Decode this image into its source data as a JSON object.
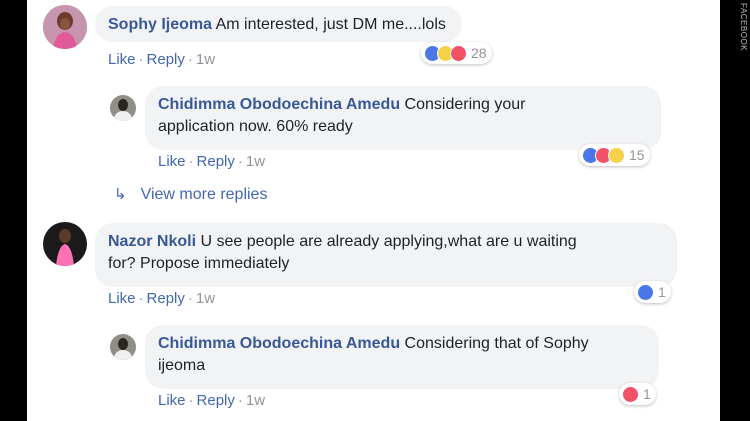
{
  "watermark": "FACEBOOK",
  "colors": {
    "name": "#385898",
    "link": "#4267b2",
    "meta": "#90949c",
    "bubble": "#f2f3f5",
    "like": "#4a76e8",
    "love": "#f25268",
    "wow": "#f7d04a"
  },
  "actions": {
    "like": "Like",
    "reply": "Reply",
    "sep": "·"
  },
  "view_more": {
    "label": "View more replies",
    "icon": "reply-arrow-icon"
  },
  "comments": [
    {
      "name": "Sophy Ijeoma",
      "text": "Am interested, just DM me....lols",
      "time": "1w",
      "reactions": [
        "like-icon",
        "wow-icon",
        "love-icon"
      ],
      "count": "28"
    },
    {
      "name": "Chidimma Obodoechina Amedu",
      "text1": "Considering your",
      "text2": "application now. 60% ready",
      "time": "1w",
      "reactions": [
        "like-icon",
        "love-icon",
        "wow-icon"
      ],
      "count": "15"
    },
    {
      "name": "Nazor Nkoli",
      "text1": "U see people are already applying,what are u waiting",
      "text2": "for? Propose immediately",
      "time": "1w",
      "reactions": [
        "like-icon"
      ],
      "count": "1"
    },
    {
      "name": "Chidimma Obodoechina Amedu",
      "text1": "Considering that of Sophy",
      "text2": "ijeoma",
      "time": "1w",
      "reactions": [
        "love-icon"
      ],
      "count": "1"
    }
  ]
}
